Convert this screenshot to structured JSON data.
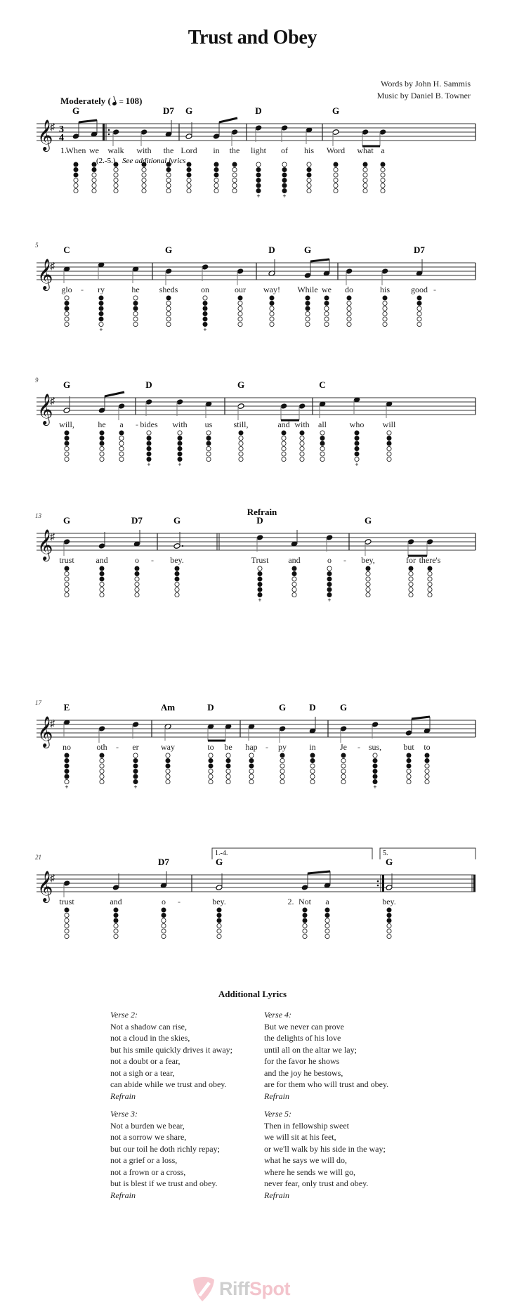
{
  "title": "Trust and Obey",
  "credits": {
    "words": "Words by John H. Sammis",
    "music": "Music by Daniel B. Towner"
  },
  "tempo": {
    "label": "Moderately",
    "bpm": "108"
  },
  "key_signature": "G major (1 sharp)",
  "time_signature": "3/4",
  "verse_marker": {
    "first": "1.",
    "others_label": "(2.-5.)",
    "others_note": "See additional lyrics"
  },
  "section_labels": {
    "refrain": "Refrain"
  },
  "volta": {
    "first": "1.-4.",
    "second": "5."
  },
  "second_verse_pickup": "2.",
  "systems": [
    {
      "measure_number": "",
      "chords": [
        {
          "n": 0,
          "c": "G"
        },
        {
          "n": 4,
          "c": "D7"
        },
        {
          "n": 5,
          "c": "G"
        },
        {
          "n": 8,
          "c": "D"
        },
        {
          "n": 11,
          "c": "G"
        }
      ],
      "notes": [
        {
          "p": "G4",
          "d": "8",
          "l": "When",
          "f": "XXXOOO"
        },
        {
          "p": "A4",
          "d": "8",
          "l": "we",
          "f": "XXOOOO"
        },
        {
          "bar": "repeat-start"
        },
        {
          "p": "B4",
          "d": "4",
          "l": "walk",
          "f": "XOOOOO"
        },
        {
          "p": "B4",
          "d": "4",
          "l": "with",
          "f": "XOOOOO"
        },
        {
          "p": "A4",
          "d": "4",
          "l": "the",
          "f": "XXOOOO"
        },
        {
          "bar": "single"
        },
        {
          "p": "G4",
          "d": "2",
          "l": "Lord",
          "f": "XXXOOO"
        },
        {
          "p": "G4",
          "d": "8",
          "l": "in",
          "f": "XXXOOO"
        },
        {
          "p": "B4",
          "d": "8",
          "l": "the",
          "f": "XOOOOO"
        },
        {
          "bar": "single"
        },
        {
          "p": "D5",
          "d": "4",
          "l": "light",
          "f": "OXXXXX+"
        },
        {
          "p": "D5",
          "d": "4",
          "l": "of",
          "f": "OXXXXX+"
        },
        {
          "p": "C5",
          "d": "4",
          "l": "his",
          "f": "OXXOOO"
        },
        {
          "bar": "single"
        },
        {
          "p": "B4",
          "d": "2",
          "l": "Word",
          "f": "XOOOOO"
        },
        {
          "p": "B4",
          "d": "8",
          "l": "what",
          "f": "XOOOOO"
        },
        {
          "p": "B4",
          "d": "8",
          "l": "a",
          "f": "XOOOOO"
        },
        {
          "bar": "single"
        }
      ]
    },
    {
      "measure_number": "5",
      "chords": [
        {
          "n": 0,
          "c": "C"
        },
        {
          "n": 3,
          "c": "G"
        },
        {
          "n": 6,
          "c": "D"
        },
        {
          "n": 7,
          "c": "G"
        },
        {
          "n": 11,
          "c": "D7"
        }
      ],
      "notes": [
        {
          "p": "C5",
          "d": "4",
          "l": "glo",
          "h": true,
          "f": "OXXOOO"
        },
        {
          "p": "E5",
          "d": "4",
          "l": "ry",
          "f": "XXXXXO+"
        },
        {
          "p": "C5",
          "d": "4",
          "l": "he",
          "f": "OXXOOO"
        },
        {
          "bar": "single"
        },
        {
          "p": "B4",
          "d": "4",
          "l": "sheds",
          "f": "XOOOOO"
        },
        {
          "p": "D5",
          "d": "4",
          "l": "on",
          "f": "OXXXXX+"
        },
        {
          "p": "B4",
          "d": "4",
          "l": "our",
          "f": "XOOOOO"
        },
        {
          "bar": "single"
        },
        {
          "p": "A4",
          "d": "2",
          "l": "way!",
          "f": "XXOOOO"
        },
        {
          "p": "G4",
          "d": "8",
          "l": "While",
          "f": "XXXOOO"
        },
        {
          "p": "A4",
          "d": "8",
          "l": "we",
          "f": "XXOOOO"
        },
        {
          "bar": "single"
        },
        {
          "p": "B4",
          "d": "4",
          "l": "do",
          "f": "XOOOOO"
        },
        {
          "p": "B4",
          "d": "4",
          "l": "his",
          "f": "XOOOOO"
        },
        {
          "p": "A4",
          "d": "4",
          "l": "good",
          "h": true,
          "f": "XXOOOO"
        },
        {
          "bar": "single"
        }
      ]
    },
    {
      "measure_number": "9",
      "chords": [
        {
          "n": 0,
          "c": "G"
        },
        {
          "n": 3,
          "c": "D"
        },
        {
          "n": 6,
          "c": "G"
        },
        {
          "n": 9,
          "c": "C"
        }
      ],
      "notes": [
        {
          "p": "G4",
          "d": "2",
          "l": "will,",
          "f": "XXXOOO"
        },
        {
          "p": "G4",
          "d": "8",
          "l": "he",
          "f": "XXXOOO"
        },
        {
          "p": "B4",
          "d": "8",
          "l": "a",
          "h": true,
          "f": "XOOOOO"
        },
        {
          "bar": "single"
        },
        {
          "p": "D5",
          "d": "4",
          "l": "bides",
          "f": "OXXXXX+"
        },
        {
          "p": "D5",
          "d": "4",
          "l": "with",
          "f": "OXXXXX+"
        },
        {
          "p": "C5",
          "d": "4",
          "l": "us",
          "f": "OXXOOO"
        },
        {
          "bar": "single"
        },
        {
          "p": "B4",
          "d": "2",
          "l": "still,",
          "f": "XOOOOO"
        },
        {
          "p": "B4",
          "d": "8",
          "l": "and",
          "f": "XOOOOO"
        },
        {
          "p": "B4",
          "d": "8",
          "l": "with",
          "f": "XOOOOO"
        },
        {
          "bar": "single"
        },
        {
          "p": "C5",
          "d": "4",
          "l": "all",
          "f": "OXXOOO"
        },
        {
          "p": "E5",
          "d": "4",
          "l": "who",
          "f": "XXXXXO+"
        },
        {
          "p": "C5",
          "d": "4",
          "l": "will",
          "f": "OXXOOO"
        },
        {
          "bar": "single"
        }
      ]
    },
    {
      "measure_number": "13",
      "chords": [
        {
          "n": 0,
          "c": "G"
        },
        {
          "n": 2,
          "c": "D7"
        },
        {
          "n": 3,
          "c": "G"
        },
        {
          "n": 4,
          "c": "D"
        },
        {
          "n": 7,
          "c": "G"
        }
      ],
      "notes": [
        {
          "p": "B4",
          "d": "4",
          "l": "trust",
          "f": "XOOOOO"
        },
        {
          "p": "G4",
          "d": "4",
          "l": "and",
          "f": "XXXOOO"
        },
        {
          "p": "A4",
          "d": "4",
          "l": "o",
          "h": true,
          "f": "XXOOOO"
        },
        {
          "bar": "single"
        },
        {
          "p": "G4",
          "d": "2.",
          "l": "bey.",
          "f": "XXXOOO"
        },
        {
          "bar": "double"
        },
        {
          "p": "D5",
          "d": "4",
          "l": "Trust",
          "f": "OXXXXX+"
        },
        {
          "p": "A4",
          "d": "4",
          "l": "and",
          "f": "XXOOOO"
        },
        {
          "p": "D5",
          "d": "4",
          "l": "o",
          "h": true,
          "f": "OXXXXX+"
        },
        {
          "bar": "single"
        },
        {
          "p": "B4",
          "d": "2",
          "l": "bey,",
          "f": "XOOOOO"
        },
        {
          "p": "B4",
          "d": "8",
          "l": "for",
          "f": "XOOOOO"
        },
        {
          "p": "B4",
          "d": "8",
          "l": "there's",
          "f": "XOOOOO"
        },
        {
          "bar": "single"
        }
      ]
    },
    {
      "measure_number": "17",
      "chords": [
        {
          "n": 0,
          "c": "E"
        },
        {
          "n": 3,
          "c": "Am"
        },
        {
          "n": 4,
          "c": "D"
        },
        {
          "n": 7,
          "c": "G"
        },
        {
          "n": 8,
          "c": "D"
        },
        {
          "n": 9,
          "c": "G"
        }
      ],
      "notes": [
        {
          "p": "E5",
          "d": "4",
          "l": "no",
          "f": "XXXXXO+"
        },
        {
          "p": "B4",
          "d": "4",
          "l": "oth",
          "h": true,
          "f": "XOOOOO"
        },
        {
          "p": "D5",
          "d": "4",
          "l": "er",
          "f": "OXXXXX+"
        },
        {
          "bar": "single"
        },
        {
          "p": "C5",
          "d": "2",
          "l": "way",
          "f": "OXXOOO"
        },
        {
          "p": "C5",
          "d": "8",
          "l": "to",
          "f": "OXXOOO"
        },
        {
          "p": "C5",
          "d": "8",
          "l": "be",
          "f": "OXXOOO"
        },
        {
          "bar": "single"
        },
        {
          "p": "C5",
          "d": "4",
          "l": "hap",
          "h": true,
          "f": "OXXOOO"
        },
        {
          "p": "B4",
          "d": "4",
          "l": "py",
          "f": "XOOOOO"
        },
        {
          "p": "A4",
          "d": "4",
          "l": "in",
          "f": "XXOOOO"
        },
        {
          "bar": "single"
        },
        {
          "p": "B4",
          "d": "4",
          "l": "Je",
          "h": true,
          "f": "XOOOOO"
        },
        {
          "p": "D5",
          "d": "4",
          "l": "sus,",
          "f": "OXXXXX+"
        },
        {
          "p": "G4",
          "d": "8",
          "l": "but",
          "f": "XXXOOO"
        },
        {
          "p": "A4",
          "d": "8",
          "l": "to",
          "f": "XXOOOO"
        },
        {
          "bar": "single"
        }
      ]
    },
    {
      "measure_number": "21",
      "chords": [
        {
          "n": 2,
          "c": "D7"
        },
        {
          "n": 3,
          "c": "G"
        },
        {
          "n": 6,
          "c": "G"
        }
      ],
      "notes": [
        {
          "p": "B4",
          "d": "4",
          "l": "trust",
          "f": "XOOOOO"
        },
        {
          "p": "G4",
          "d": "4",
          "l": "and",
          "f": "XXXOOO"
        },
        {
          "p": "A4",
          "d": "4",
          "l": "o",
          "h": true,
          "f": "XXOOOO"
        },
        {
          "bar": "single"
        },
        {
          "p": "G4",
          "d": "2",
          "l": "bey.",
          "f": "XXXOOO"
        },
        {
          "p": "G4",
          "d": "8",
          "l": "Not",
          "f": "XXXOOO"
        },
        {
          "p": "A4",
          "d": "8",
          "l": "a",
          "f": "XXOOOO"
        },
        {
          "bar": "repeat-end"
        },
        {
          "p": "G4",
          "d": "2",
          "l": "bey.",
          "f": "XXXOOO"
        },
        {
          "bar": "final"
        }
      ]
    }
  ],
  "additional_lyrics": {
    "title": "Additional Lyrics",
    "refrain_label": "Refrain",
    "verses": [
      {
        "label": "Verse 2:",
        "lines": [
          "Not a shadow can rise,",
          "not a cloud in the skies,",
          "but his smile quickly drives it away;",
          "not a doubt or a fear,",
          "not a sigh or a tear,",
          "can abide while we trust and obey."
        ]
      },
      {
        "label": "Verse 3:",
        "lines": [
          "Not a burden we bear,",
          "not a sorrow we share,",
          "but our toil he doth richly repay;",
          "not a grief or a loss,",
          "not a frown or a cross,",
          "but is blest if we trust and obey."
        ]
      },
      {
        "label": "Verse 4:",
        "lines": [
          "But we never can prove",
          "the delights of his love",
          "until all on the altar we lay;",
          "for the favor he shows",
          "and the joy he bestows,",
          "are for them who will trust and obey."
        ]
      },
      {
        "label": "Verse 5:",
        "lines": [
          "Then in fellowship sweet",
          "we will sit at his feet,",
          "or we'll walk by his side in the way;",
          "what he says we will do,",
          "where he sends we will go,",
          "never fear, only trust and obey."
        ]
      }
    ]
  },
  "logo": {
    "part1": "Riff",
    "part2": "Spot",
    "brand_color": "#f3c4cc"
  }
}
